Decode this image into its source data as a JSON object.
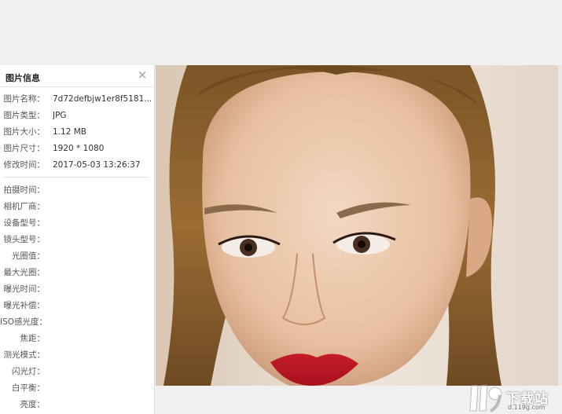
{
  "panel": {
    "title": "图片信息",
    "close_symbol": "×",
    "basic": [
      {
        "label": "图片名称：",
        "value": "7d72defbjw1er8f5181..."
      },
      {
        "label": "图片类型：",
        "value": "JPG"
      },
      {
        "label": "图片大小：",
        "value": "1.12 MB"
      },
      {
        "label": "图片尺寸：",
        "value": "1920 * 1080"
      },
      {
        "label": "修改时间：",
        "value": "2017-05-03 13:26:37"
      }
    ],
    "exif": [
      {
        "label": "拍摄时间：",
        "value": ""
      },
      {
        "label": "相机厂商：",
        "value": ""
      },
      {
        "label": "设备型号：",
        "value": ""
      },
      {
        "label": "镜头型号：",
        "value": ""
      },
      {
        "label": "光圈值：",
        "value": ""
      },
      {
        "label": "最大光圈：",
        "value": ""
      },
      {
        "label": "曝光时间：",
        "value": ""
      },
      {
        "label": "曝光补偿：",
        "value": ""
      },
      {
        "label": "ISO感光度：",
        "value": ""
      },
      {
        "label": "焦距：",
        "value": ""
      },
      {
        "label": "测光模式：",
        "value": ""
      },
      {
        "label": "闪光灯：",
        "value": ""
      },
      {
        "label": "白平衡：",
        "value": ""
      },
      {
        "label": "亮度：",
        "value": ""
      }
    ]
  },
  "watermark": {
    "logo_text": "下载站",
    "domain": "d.119g.com"
  }
}
